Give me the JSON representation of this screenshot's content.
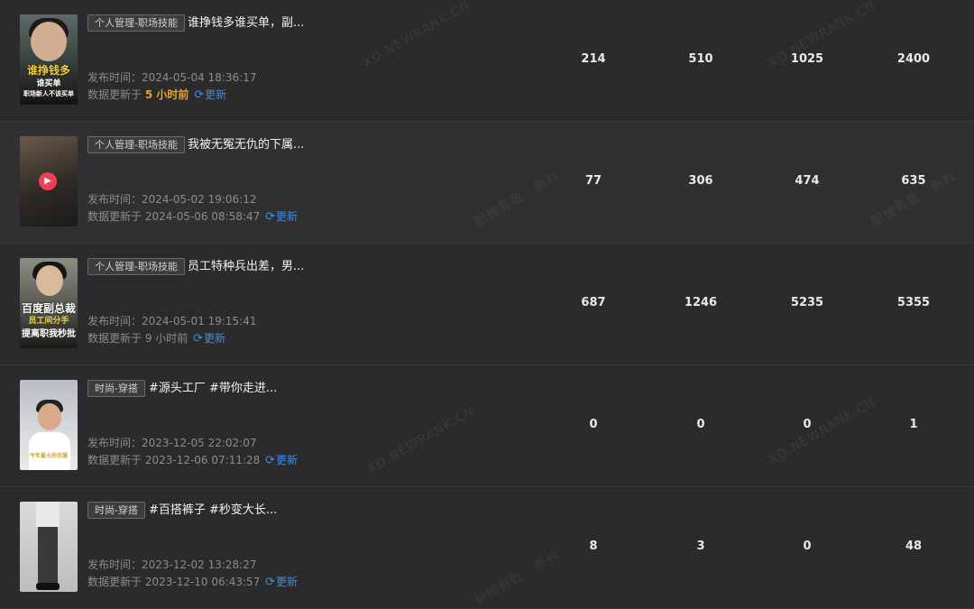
{
  "labels": {
    "publish_prefix": "发布时间：",
    "update_prefix": "数据更新于 ",
    "refresh": "更新"
  },
  "watermarks": {
    "domain": "XD.NEWRANK.CN",
    "brand": "新榜有数 · 新抖"
  },
  "rows": [
    {
      "thumb_text": [
        "谁挣钱多",
        "谁买单",
        "职场新人不该买单"
      ],
      "tag": "个人管理-职场技能",
      "title": "谁挣钱多谁买单，副...",
      "publish_time": "2024-05-04 18:36:17",
      "update_time": "5 小时前",
      "update_recent": true,
      "stats": [
        "214",
        "510",
        "1025",
        "2400"
      ]
    },
    {
      "thumb_text": [],
      "tag": "个人管理-职场技能",
      "title": "我被无冤无仇的下属...",
      "publish_time": "2024-05-02 19:06:12",
      "update_time": "2024-05-06 08:58:47",
      "update_recent": false,
      "stats": [
        "77",
        "306",
        "474",
        "635"
      ]
    },
    {
      "thumb_text": [
        "百度副总裁",
        "员工间分手",
        "提离职我秒批"
      ],
      "tag": "个人管理-职场技能",
      "title": "员工特种兵出差，男...",
      "publish_time": "2024-05-01 19:15:41",
      "update_time": "9 小时前",
      "update_recent": false,
      "stats": [
        "687",
        "1246",
        "5235",
        "5355"
      ]
    },
    {
      "thumb_text": [
        "今年最火的衣服"
      ],
      "tag": "时尚-穿搭",
      "title": "#源头工厂 #带你走进...",
      "publish_time": "2023-12-05 22:02:07",
      "update_time": "2023-12-06 07:11:28",
      "update_recent": false,
      "stats": [
        "0",
        "0",
        "0",
        "1"
      ]
    },
    {
      "thumb_text": [],
      "tag": "时尚-穿搭",
      "title": "#百搭裤子 #秒变大长...",
      "publish_time": "2023-12-02 13:28:27",
      "update_time": "2023-12-10 06:43:57",
      "update_recent": false,
      "stats": [
        "8",
        "3",
        "0",
        "48"
      ]
    }
  ]
}
